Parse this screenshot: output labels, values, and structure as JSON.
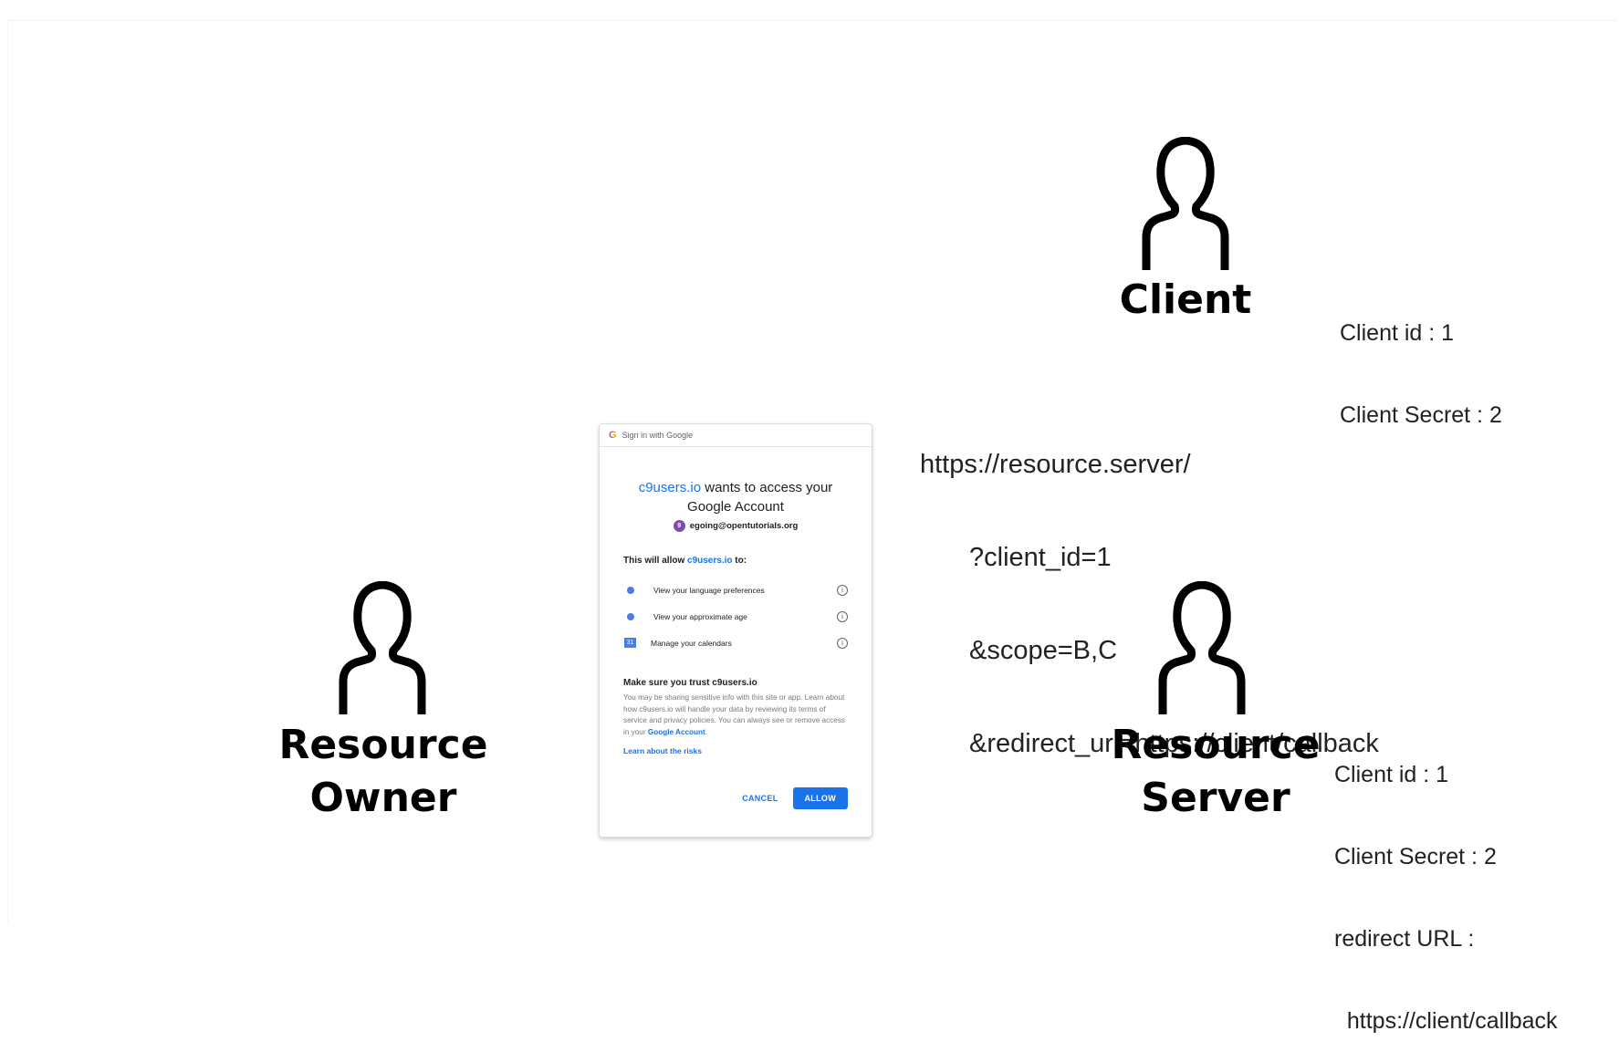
{
  "actors": {
    "client": {
      "line1": "Client",
      "line2": ""
    },
    "owner": {
      "line1": "Resource",
      "line2": "Owner"
    },
    "server": {
      "line1": "Resource",
      "line2": "Server"
    }
  },
  "client_info": [
    "Client id : 1",
    "Client Secret : 2"
  ],
  "server_info": [
    "Client id : 1",
    "Client Secret : 2",
    "redirect URL :",
    "  https://client/callback"
  ],
  "request_url": [
    "https://resource.server/",
    "?client_id=1",
    "&scope=B,C",
    "&redirect_uri=https://client/callback"
  ],
  "dialog": {
    "header": "Sign in with Google",
    "logo": "G",
    "app_name": "c9users.io",
    "title_rest": " wants to access your",
    "title_line2": "Google Account",
    "avatar_letter": "9",
    "account": "egoing@opentutorials.org",
    "allow_prefix": "This will allow ",
    "allow_app": "c9users.io",
    "allow_suffix": " to:",
    "permissions": [
      {
        "icon": "dot-icon",
        "text": "View your language preferences"
      },
      {
        "icon": "dot-icon",
        "text": "View your approximate age"
      },
      {
        "icon": "calendar-icon",
        "text": "Manage your calendars"
      }
    ],
    "calendar_icon_text": "31",
    "info_icon_text": "i",
    "trust_title": "Make sure you trust c9users.io",
    "trust_body": "You may be sharing sensitive info with this site or app. Learn about how c9users.io will handle your data by reviewing its terms of service and privacy policies. You can always see or remove access in your ",
    "trust_link": "Google Account",
    "trust_end": ".",
    "risks_link": "Learn about the risks",
    "cancel": "CANCEL",
    "allow": "ALLOW"
  }
}
